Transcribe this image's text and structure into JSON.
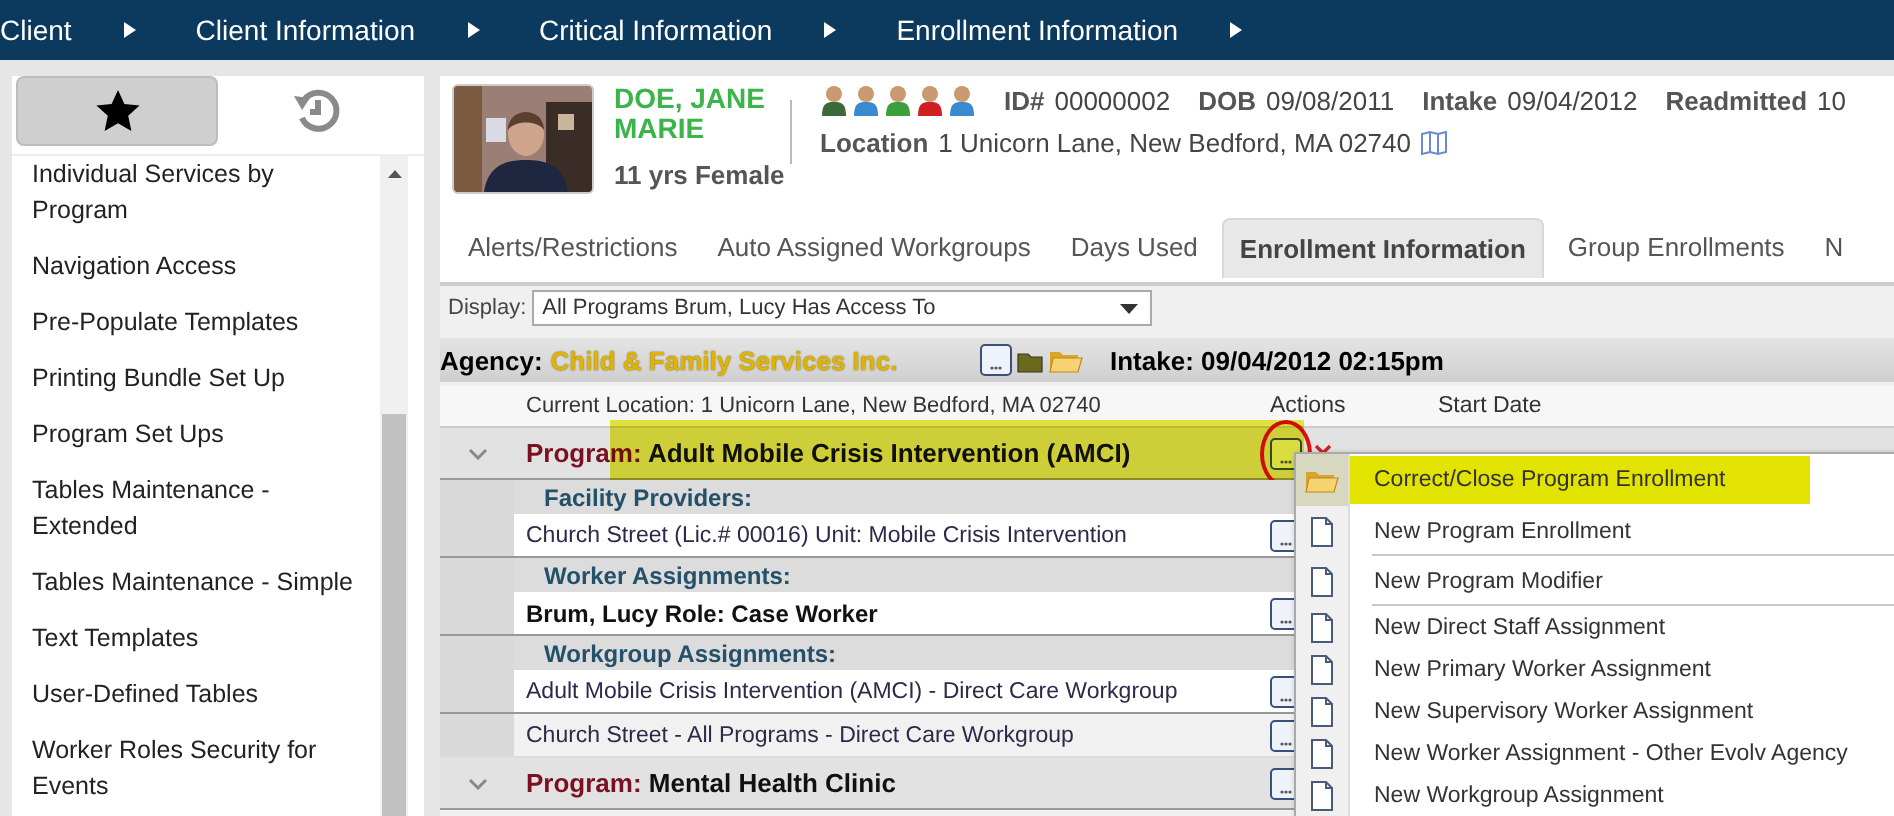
{
  "nav": [
    {
      "label": "Client"
    },
    {
      "label": "Client Information"
    },
    {
      "label": "Critical Information"
    },
    {
      "label": "Enrollment Information"
    }
  ],
  "sidebar": {
    "tabs": [
      {
        "kind": "favorites",
        "selected": true
      },
      {
        "kind": "history",
        "selected": false
      }
    ],
    "items": [
      "Individual Services by Program",
      "Navigation Access",
      "Pre-Populate Templates",
      "Printing Bundle Set Up",
      "Program Set Ups",
      "Tables Maintenance - Extended",
      "Tables Maintenance - Simple",
      "Text Templates",
      "User-Defined Tables",
      "Worker Roles Security for Events"
    ]
  },
  "client": {
    "name": "DOE, JANE MARIE",
    "age_sex": "11 yrs Female",
    "fields": [
      {
        "label": "ID#",
        "value": "00000002"
      },
      {
        "label": "DOB",
        "value": "09/08/2011"
      },
      {
        "label": "Intake",
        "value": "09/04/2012"
      },
      {
        "label": "Readmitted",
        "value": "10"
      }
    ],
    "location": {
      "label": "Location",
      "value": "1 Unicorn Lane, New Bedford, MA 02740"
    }
  },
  "tabs": [
    {
      "label": "Alerts/Restrictions",
      "selected": false
    },
    {
      "label": "Auto Assigned Workgroups",
      "selected": false
    },
    {
      "label": "Days Used",
      "selected": false
    },
    {
      "label": "Enrollment Information",
      "selected": true
    },
    {
      "label": "Group Enrollments",
      "selected": false
    },
    {
      "label": "N",
      "selected": false
    }
  ],
  "display": {
    "label": "Display:",
    "value": "All Programs Brum, Lucy Has Access To"
  },
  "agency": {
    "label": "Agency:",
    "name": "Child & Family Services Inc.",
    "intake": "Intake: 09/04/2012 02:15pm"
  },
  "columns": [
    "Current Location: 1 Unicorn Lane, New Bedford, MA 02740",
    "Actions",
    "Start Date"
  ],
  "programs": [
    {
      "label": "Program:",
      "name": "Adult Mobile Crisis Intervention (AMCI)",
      "highlighted": true,
      "action_circled": true,
      "sections": [
        {
          "title": "Facility Providers:",
          "rows": [
            {
              "text": "Church Street (Lic.# 00016) Unit: Mobile Crisis Intervention",
              "bold": false
            }
          ]
        },
        {
          "title": "Worker Assignments:",
          "rows": [
            {
              "text": "Brum, Lucy Role: Case Worker",
              "bold": true
            }
          ]
        },
        {
          "title": "Workgroup Assignments:",
          "rows": [
            {
              "text": "Adult Mobile Crisis Intervention (AMCI) - Direct Care Workgroup",
              "bold": false
            },
            {
              "text": "Church Street - All Programs - Direct Care Workgroup",
              "bold": false
            }
          ]
        }
      ]
    },
    {
      "label": "Program:",
      "name": "Mental Health Clinic",
      "highlighted": false,
      "action_circled": false
    }
  ],
  "context_menu": {
    "items": [
      {
        "label": "Correct/Close Program Enrollment",
        "highlighted": true,
        "separator_after": false
      },
      {
        "label": "New Program Enrollment",
        "highlighted": false,
        "separator_after": true
      },
      {
        "label": "New Program Modifier",
        "highlighted": false,
        "separator_after": true
      },
      {
        "label": "New Direct Staff Assignment",
        "highlighted": false,
        "separator_after": false
      },
      {
        "label": "New Primary Worker Assignment",
        "highlighted": false,
        "separator_after": false
      },
      {
        "label": "New Supervisory Worker Assignment",
        "highlighted": false,
        "separator_after": false
      },
      {
        "label": "New Worker Assignment - Other Evolv Agency",
        "highlighted": false,
        "separator_after": false
      },
      {
        "label": "New Workgroup Assignment",
        "highlighted": false,
        "separator_after": false
      }
    ]
  }
}
